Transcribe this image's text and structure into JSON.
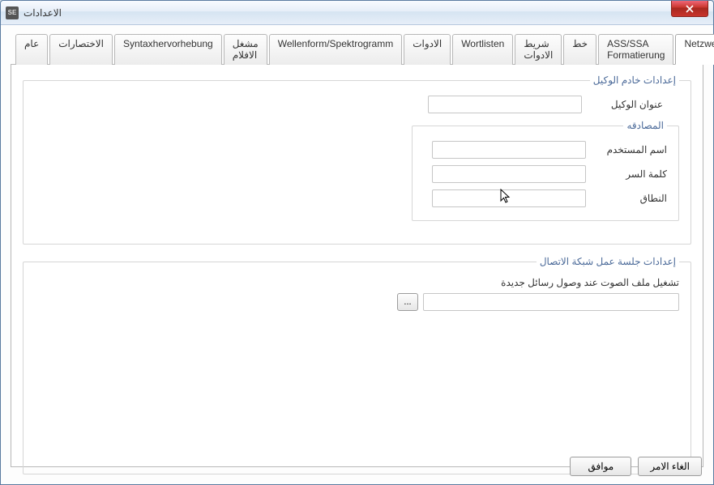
{
  "window": {
    "title": "الاعدادات"
  },
  "tabs": [
    {
      "label": "عام"
    },
    {
      "label": "الاختصارات"
    },
    {
      "label": "Syntaxhervorhebung"
    },
    {
      "label": "مشغل الافلام"
    },
    {
      "label": "Wellenform/Spektrogramm"
    },
    {
      "label": "الادوات"
    },
    {
      "label": "Wortlisten"
    },
    {
      "label": "شريط الادوات"
    },
    {
      "label": "خط"
    },
    {
      "label": "ASS/SSA Formatierung"
    },
    {
      "label": "Netzwerk"
    }
  ],
  "active_tab_index": 10,
  "proxy": {
    "legend": "إعدادات خادم الوكيل",
    "address_label": "عنوان الوكيل",
    "address_value": "",
    "auth": {
      "legend": "المصادقه",
      "username_label": "اسم المستخدم",
      "username_value": "",
      "password_label": "كلمة السر",
      "password_value": "",
      "domain_label": "النطاق",
      "domain_value": ""
    }
  },
  "session": {
    "legend": "إعدادات جلسة عمل شبكة الاتصال",
    "sound_label": "تشغيل ملف الصوت عند وصول رسائل جديدة",
    "sound_value": "",
    "browse_label": "..."
  },
  "buttons": {
    "ok": "موافق",
    "cancel": "الغاء الامر"
  }
}
